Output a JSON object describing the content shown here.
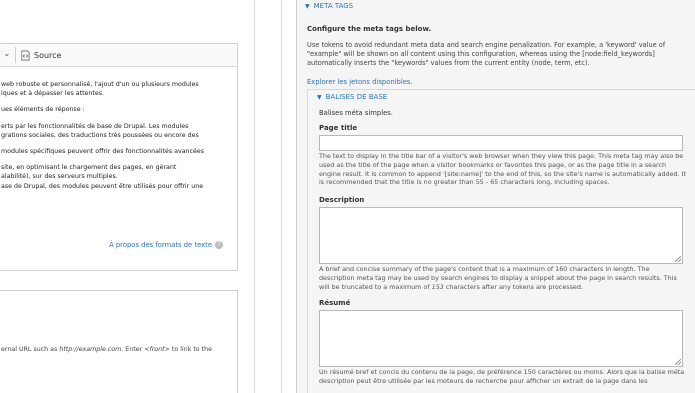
{
  "editor": {
    "source_label": "Source",
    "paragraphs": [
      "web robuste et personnalisé, l'ajout  d'un ou plusieurs modules",
      "iques et à dépasser les attentes.",
      "ues éléments de réponse :",
      "erts par les fonctionnalités de base de Drupal. Les modules",
      "grations sociales, des traductions très poussées ou encore des",
      "modules spécifiques peuvent offrir des fonctionnalités avancées",
      "site, en optimisant le chargement des pages, en gérant",
      "alabilité), sur des serveurs multiples.",
      "ase de Drupal, des modules peuvent être utilisés pour offrir une"
    ],
    "formats_link": "À propos des formats de texte",
    "help_icon": "?"
  },
  "url": {
    "help_pre": "ernal URL such as ",
    "help_example": "http://example.com",
    "help_mid": ". Enter ",
    "help_front": "<front>",
    "help_post": " to link to the"
  },
  "meta": {
    "summary": "META TAGS",
    "intro": "Configure the meta tags below.",
    "description": "Use tokens to avoid redundant meta data and search engine penalization. For example, a 'keyword' value of \"example\" will be shown on all content using this configuration, whereas using the [node:field_keywords] automatically inserts the \"keywords\" values from the current entity (node, term, etc).",
    "tokens_link": "Explorer les jetons disponibles.",
    "basic": {
      "summary": "BALISES DE BASE",
      "intro": "Balises méta simples.",
      "page_title_label": "Page title",
      "page_title_value": "",
      "page_title_help": "The text to display in the title bar of a visitor's web browser when they view this page. This meta tag may also be used as the title of the page when a visitor bookmarks or favorites this page, or as the page title in a search engine result. It is common to append '[site:name]' to the end of this, so the site's name is automatically added. It is recommended that the title is no greater than 55 - 65 characters long, including spaces.",
      "description_label": "Description",
      "description_value": "",
      "description_help_pre": "A brief and concise summary of the page's content that is a maximum of 160 characters in length. The description meta tag may be used by search engines to display a snippet about the page in search results. This will be truncated to a maximum of ",
      "description_help_num": "153",
      "description_help_post": " characters after any tokens are processed.",
      "resume_label": "Résumé",
      "resume_value": "",
      "resume_help": "Un résumé bref et concis du contenu de la page, de préférence 150 caractères ou moins. Alors que la balise méta description peut être utilisée par les moteurs de recherche pour afficher un extrait de la page dans les"
    }
  },
  "colors": {
    "link": "#2a73b8",
    "panel_bg": "#f5f5f5",
    "border": "#cccccc"
  }
}
